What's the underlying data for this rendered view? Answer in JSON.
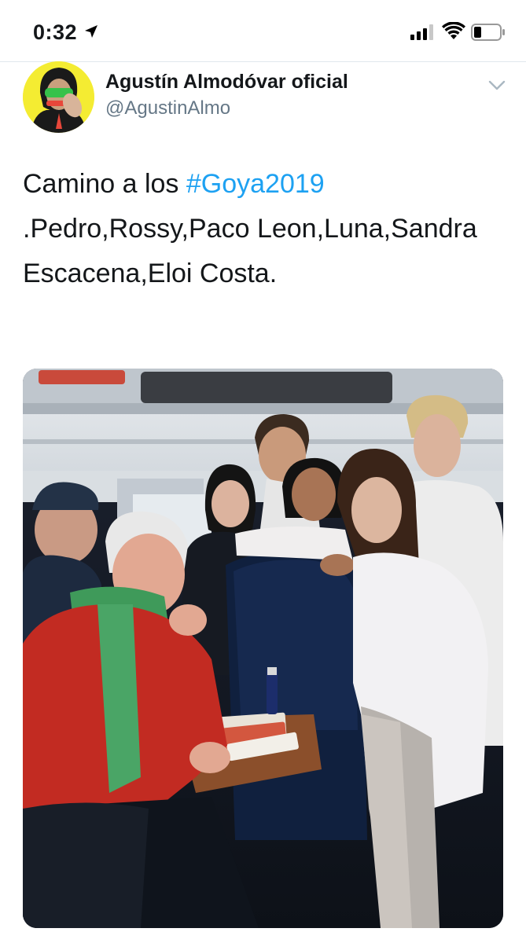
{
  "status": {
    "time": "0:32",
    "icons": [
      "location-arrow-icon",
      "signal-icon",
      "wifi-icon",
      "battery-icon"
    ]
  },
  "tweet": {
    "author": {
      "display_name": "Agustín Almodóvar oficial",
      "handle": "@AgustinAlmo"
    },
    "text_before": "Camino a los ",
    "hashtag": "#Goya2019",
    "text_after": " .Pedro,Rossy,Paco Leon,Luna,Sandra Escacena,Eloi Costa.",
    "hashtag_color": "#1da1f2",
    "media": {
      "type": "photo",
      "description_icon": "photo"
    }
  },
  "colors": {
    "text": "#14171a",
    "secondary": "#657786",
    "link": "#1da1f2",
    "divider": "#e1e8ed"
  }
}
